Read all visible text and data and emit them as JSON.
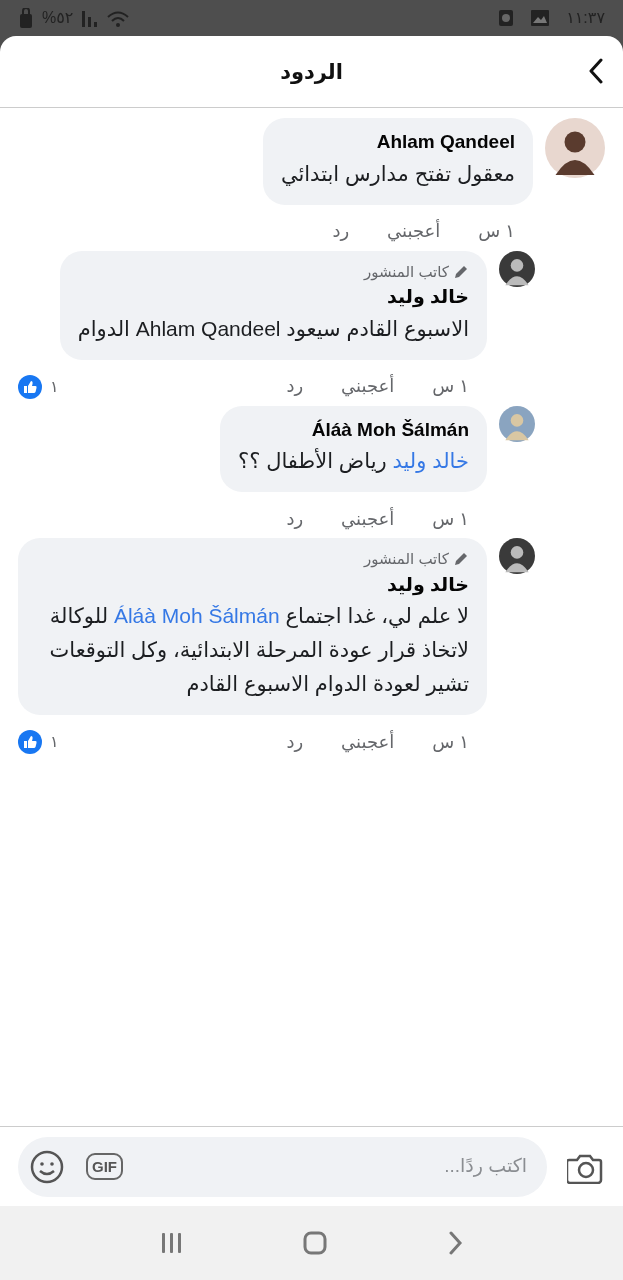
{
  "status_bar": {
    "time": "١١:٣٧",
    "battery": "%٥٢"
  },
  "header": {
    "title": "الردود"
  },
  "comments": [
    {
      "kind": "comment",
      "author": "Ahlam Qandeel",
      "segments": [
        {
          "text": "معقول تفتح مدارس ابتدائي",
          "mention": false
        }
      ],
      "time": "١ س",
      "like": "أعجبني",
      "reply": "رد"
    },
    {
      "kind": "reply",
      "badge": "كاتب المنشور",
      "author": "خالد وليد",
      "segments": [
        {
          "text": "الاسبوع القادم سيعود Ahlam Qandeel الدوام",
          "mention": false
        }
      ],
      "time": "١ س",
      "like": "أعجبني",
      "reply": "رد",
      "reaction_count": "١"
    },
    {
      "kind": "reply",
      "author": "Áláà Moh Šálmán",
      "segments": [
        {
          "text": "خالد وليد",
          "mention": true
        },
        {
          "text": " رياض الأطفال ؟؟",
          "mention": false
        }
      ],
      "time": "١ س",
      "like": "أعجبني",
      "reply": "رد"
    },
    {
      "kind": "reply",
      "badge": "كاتب المنشور",
      "author": "خالد وليد",
      "segments": [
        {
          "text": "لا علم لي،  غدا اجتماع ",
          "mention": false
        },
        {
          "text": "Áláà Moh Šálmán",
          "mention": true
        },
        {
          "text": " للوكالة لاتخاذ قرار عودة المرحلة الابتدائية، وكل التوقعات تشير لعودة الدوام الاسبوع القادم",
          "mention": false
        }
      ],
      "time": "١ س",
      "like": "أعجبني",
      "reply": "رد",
      "reaction_count": "١"
    }
  ],
  "composer": {
    "placeholder": "اكتب ردًا...",
    "gif": "GIF"
  }
}
